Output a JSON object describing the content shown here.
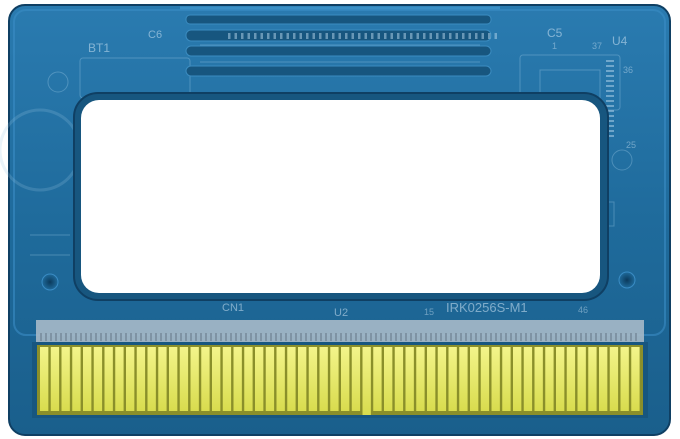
{
  "cartridge": {
    "colors": {
      "shell": "#1f6b9c",
      "shell_dark": "#17567f",
      "edge": "#0f3f63",
      "label_window": "#ffffff",
      "pins": "#e8ec6a",
      "pin_gap": "#8a8f2a",
      "contact_strip": "#a7b9c8"
    },
    "silkscreen": {
      "bt1": "BT1",
      "c6": "C6",
      "c5": "C5",
      "u4": "U4",
      "n1": "1",
      "n37": "37",
      "n36": "36",
      "n25": "25",
      "cn1": "CN1",
      "u2": "U2",
      "n15": "15",
      "board_id": "IRK0256S-M1",
      "n46": "46"
    },
    "label_window_text": "",
    "edge_connector": {
      "pin_count": 56
    }
  }
}
